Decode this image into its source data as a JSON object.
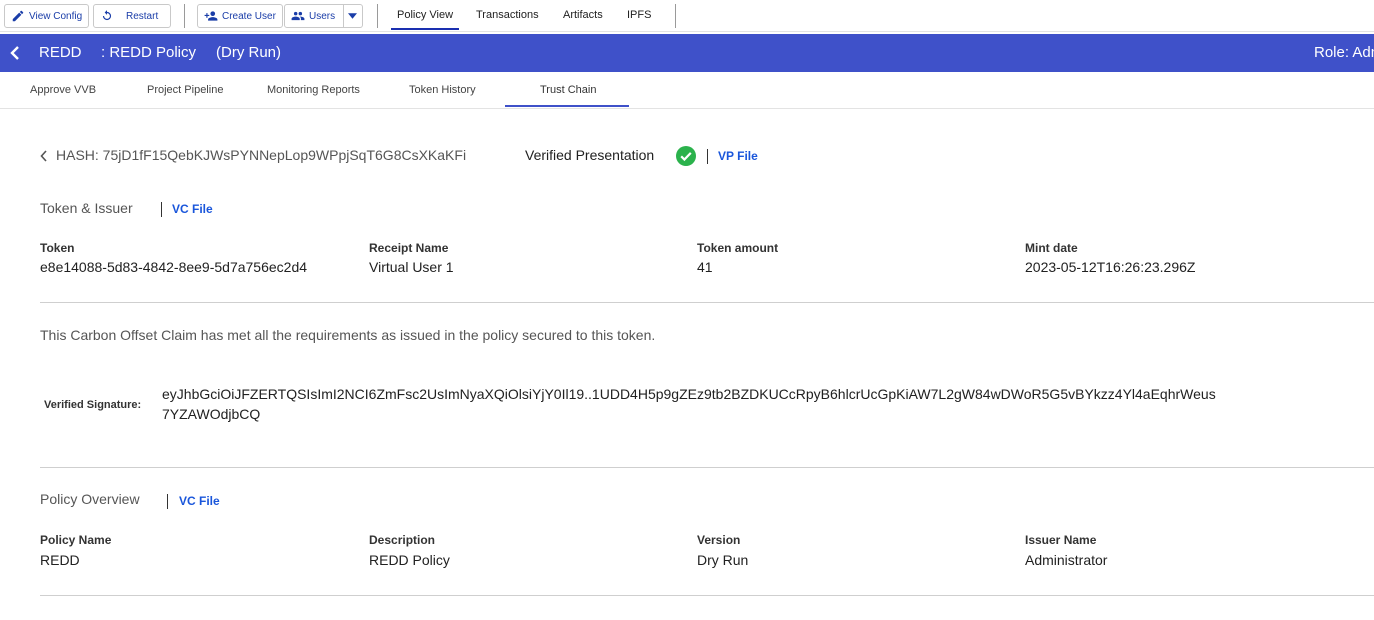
{
  "toolbar": {
    "view_config": "View Config",
    "restart": "Restart",
    "create_user": "Create User",
    "users": "Users",
    "tabs": [
      "Policy View",
      "Transactions",
      "Artifacts",
      "IPFS"
    ]
  },
  "header": {
    "policy_short": "REDD",
    "policy_title": ": REDD Policy",
    "mode": "(Dry Run)",
    "role": "Role: Adm"
  },
  "subtabs": [
    "Approve VVB",
    "Project Pipeline",
    "Monitoring Reports",
    "Token History",
    "Trust Chain"
  ],
  "trust_chain": {
    "hash": "HASH: 75jD1fF15QebKJWsPYNNepLop9WPpjSqT6G8CsXKaKFi",
    "vp_title": "Verified Presentation",
    "vp_file": "VP File",
    "token_section": {
      "title": "Token & Issuer",
      "file_link": "VC File",
      "fields": [
        {
          "label": "Token",
          "value": "e8e14088-5d83-4842-8ee9-5d7a756ec2d4"
        },
        {
          "label": "Receipt Name",
          "value": "Virtual User 1"
        },
        {
          "label": "Token amount",
          "value": "41"
        },
        {
          "label": "Mint date",
          "value": "2023-05-12T16:26:23.296Z"
        }
      ]
    },
    "claim_text": "This Carbon Offset Claim has met all the requirements as issued in the policy secured to this token.",
    "signature_label": "Verified Signature:",
    "signature_value": "eyJhbGciOiJFZERTQSIsImI2NCI6ZmFsc2UsImNyaXQiOlsiYjY0Il19..1UDD4H5p9gZEz9tb2BZDKUCcRpyB6hlcrUcGpKiAW7L2gW84wDWoR5G5vBYkzz4Yl4aEqhrWeus7YZAWOdjbCQ",
    "policy_section": {
      "title": "Policy Overview",
      "file_link": "VC File",
      "fields": [
        {
          "label": "Policy Name",
          "value": "REDD"
        },
        {
          "label": "Description",
          "value": "REDD Policy"
        },
        {
          "label": "Version",
          "value": "Dry Run"
        },
        {
          "label": "Issuer Name",
          "value": "Administrator"
        }
      ]
    }
  },
  "colors": {
    "header_bg": "#3f51c9",
    "link": "#1a56db",
    "verified_green": "#2bb24c"
  }
}
